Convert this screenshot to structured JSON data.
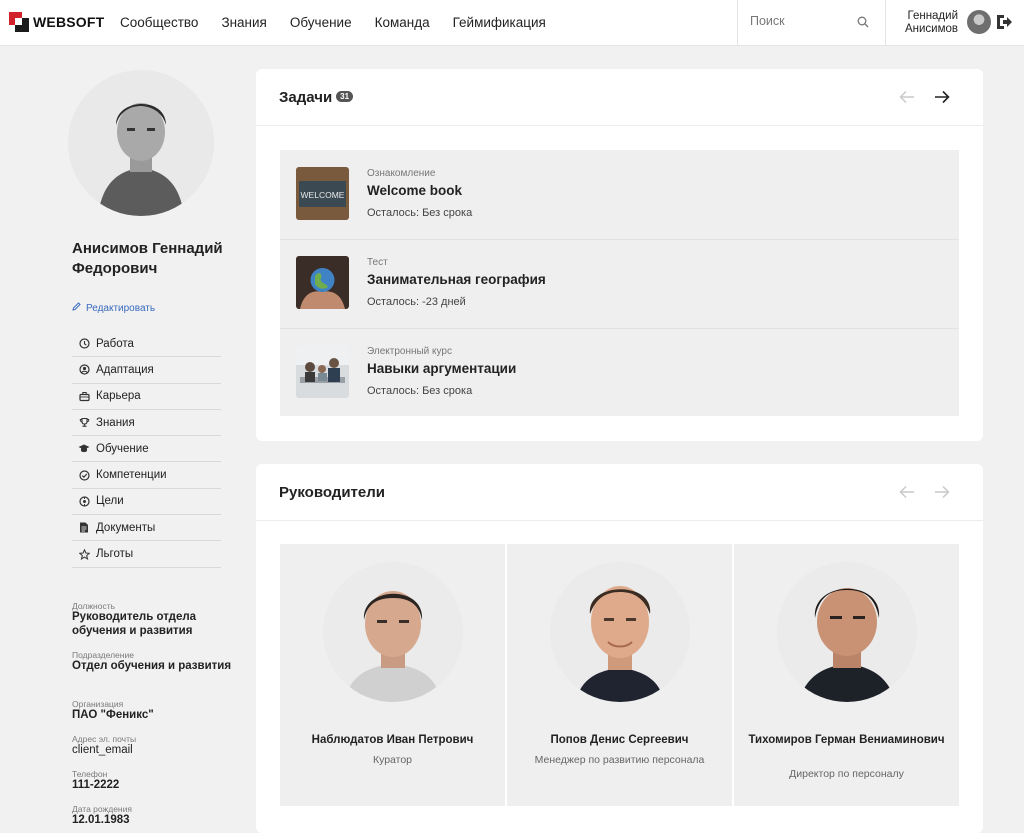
{
  "brand": {
    "name": "WEBSOFT",
    "accent": "#d2232a"
  },
  "nav": {
    "items": [
      "Сообщество",
      "Знания",
      "Обучение",
      "Команда",
      "Геймификация"
    ]
  },
  "search": {
    "placeholder": "Поиск",
    "icon": "search-icon"
  },
  "user": {
    "first": "Геннадий",
    "last": "Анисимов"
  },
  "profile": {
    "name": "Анисимов Геннадий Федорович",
    "edit_label": "Редактировать",
    "menu": [
      {
        "label": "Работа",
        "icon": "clock-icon"
      },
      {
        "label": "Адаптация",
        "icon": "user-circle-icon"
      },
      {
        "label": "Карьера",
        "icon": "briefcase-icon"
      },
      {
        "label": "Знания",
        "icon": "trophy-icon"
      },
      {
        "label": "Обучение",
        "icon": "graduation-cap-icon"
      },
      {
        "label": "Компетенции",
        "icon": "check-circle-icon"
      },
      {
        "label": "Цели",
        "icon": "target-icon"
      },
      {
        "label": "Документы",
        "icon": "document-icon"
      },
      {
        "label": "Льготы",
        "icon": "star-icon"
      }
    ],
    "info": [
      {
        "label": "Должность",
        "value": "Руководитель отдела обучения и развития"
      },
      {
        "label": "Подразделение",
        "value": "Отдел обучения и развития"
      },
      {
        "label": "Организация",
        "value": "ПАО \"Феникс\""
      },
      {
        "label": "Адрес эл. почты",
        "value": "client_email"
      },
      {
        "label": "Телефон",
        "value": "111-2222"
      },
      {
        "label": "Дата рождения",
        "value": "12.01.1983"
      }
    ]
  },
  "tasks": {
    "title": "Задачи",
    "count": "31",
    "items": [
      {
        "type": "Ознакомление",
        "title": "Welcome book",
        "remaining": "Осталось: Без срока",
        "thumb_text": "WELCOME"
      },
      {
        "type": "Тест",
        "title": "Занимательная география",
        "remaining": "Осталось: -23 дней"
      },
      {
        "type": "Электронный курс",
        "title": "Навыки аргументации",
        "remaining": "Осталось: Без срока"
      }
    ]
  },
  "managers": {
    "title": "Руководители",
    "items": [
      {
        "name": "Наблюдатов Иван Петрович",
        "role": "Куратор"
      },
      {
        "name": "Попов Денис Сергеевич",
        "role": "Менеджер по развитию персонала"
      },
      {
        "name": "Тихомиров Герман Вениаминович",
        "role": "Директор по персоналу"
      }
    ]
  }
}
